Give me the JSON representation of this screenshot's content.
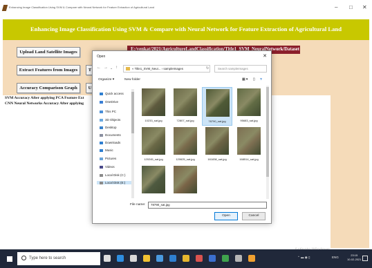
{
  "window": {
    "title": "Enhancing Image Classification Using SVM & Compare with Neural Network for Feature Extraction of Agricultural Land",
    "minimize": "–",
    "maximize": "□",
    "close": "✕"
  },
  "app": {
    "banner_title": "Enhancing Image Classification Using SVM & Compare with Neural Network for Feature Extraction of Agricultural Land",
    "buttons": {
      "upload": "Upload Land Satellite Images",
      "extract": "Extract Features from Images",
      "comparison": "Accuracy Comparison Graph",
      "partial_t": "T",
      "partial_u": "U"
    },
    "path_label": "E:/venkat/2021/AgricultureLandClassification/Title1_SVM_NeuralNetwork/Dataset",
    "output_lines": [
      "SVM Accuracy After applying PCA Feature Ext",
      "CNN Neural Networks Accuracy After applying"
    ],
    "watermark_line1": "Activate Windows",
    "watermark_line2": "Go to Settings to activate Windows."
  },
  "dialog": {
    "title": "Open",
    "breadcrumb": "« Title1_SVM_Neur... › sampleImages",
    "search_placeholder": "Search sampleImages",
    "toolbar": {
      "organize": "Organize ▾",
      "new_folder": "New folder"
    },
    "nav_items": [
      {
        "label": "Quick access",
        "icon": "star-icon",
        "color": "#2f7fd0"
      },
      {
        "label": "OneDrive",
        "icon": "cloud-icon",
        "color": "#3a7fd5"
      },
      {
        "label": "This PC",
        "icon": "computer-icon",
        "color": "#4a8fd8"
      },
      {
        "label": "3D Objects",
        "icon": "cube-icon",
        "color": "#6aa9e0"
      },
      {
        "label": "Desktop",
        "icon": "desktop-icon",
        "color": "#3a83cc"
      },
      {
        "label": "Documents",
        "icon": "document-icon",
        "color": "#8a8fa0"
      },
      {
        "label": "Downloads",
        "icon": "download-icon",
        "color": "#2f7fd0"
      },
      {
        "label": "Music",
        "icon": "music-icon",
        "color": "#2f7fd0"
      },
      {
        "label": "Pictures",
        "icon": "pictures-icon",
        "color": "#6aa3d8"
      },
      {
        "label": "Videos",
        "icon": "video-icon",
        "color": "#4a4a8a"
      },
      {
        "label": "Local Disk (C:)",
        "icon": "disk-icon",
        "color": "#8a8a8a"
      },
      {
        "label": "Local Disk (E:)",
        "icon": "disk-icon",
        "color": "#8a8a8a",
        "selected": true
      }
    ],
    "files": [
      {
        "name": "10233_sat.jpg",
        "color": "#5e5a3e",
        "selected": false
      },
      {
        "name": "72807_sat.jpg",
        "color": "#6b6a48",
        "selected": false
      },
      {
        "name": "78790_sat.jpg",
        "color": "#4f5a36",
        "selected": true
      },
      {
        "name": "95683_sat.jpg",
        "color": "#626c45",
        "selected": false
      },
      {
        "name": "120245_sat.jpg",
        "color": "#6a6846",
        "selected": false
      },
      {
        "name": "120625_sat.jpg",
        "color": "#7a6b4c",
        "selected": false
      },
      {
        "name": "161838_sat.jpg",
        "color": "#6c6345",
        "selected": false
      },
      {
        "name": "168514_sat.jpg",
        "color": "#7d6f52",
        "selected": false
      },
      {
        "name": "",
        "color": "#4f5a40",
        "selected": false
      },
      {
        "name": "",
        "color": "#7a6447",
        "selected": false
      }
    ],
    "filename_label": "File name:",
    "filename_value": "78790_sat.jpg",
    "open_label": "Open",
    "cancel_label": "Cancel"
  },
  "taskbar": {
    "search_placeholder": "Type here to search",
    "apps": [
      {
        "icon": "task-view-icon",
        "color": "#dddddd"
      },
      {
        "icon": "edge-icon",
        "color": "#2e8ee0"
      },
      {
        "icon": "store-icon",
        "color": "#d8d8d8"
      },
      {
        "icon": "file-explorer-icon",
        "color": "#f1c232"
      },
      {
        "icon": "mail-icon",
        "color": "#4a9ae0"
      },
      {
        "icon": "ie-icon",
        "color": "#2e7fd0"
      },
      {
        "icon": "chrome-icon",
        "color": "#e5b62e"
      },
      {
        "icon": "app-icon-red",
        "color": "#d9534f"
      },
      {
        "icon": "app-icon-blue",
        "color": "#3b6fcf"
      },
      {
        "icon": "app-icon-green",
        "color": "#3fa34d"
      },
      {
        "icon": "app-icon-gray",
        "color": "#b5b5b5"
      },
      {
        "icon": "python-icon",
        "color": "#f0a030"
      }
    ],
    "tray_text": "ENG",
    "time": "23:15",
    "date": "10-02-2021"
  },
  "colors": {
    "banner": "#c8c800",
    "panel": "#f5dbb9",
    "path_label_bg": "#8b1f2b",
    "taskbar": "#20283a"
  }
}
